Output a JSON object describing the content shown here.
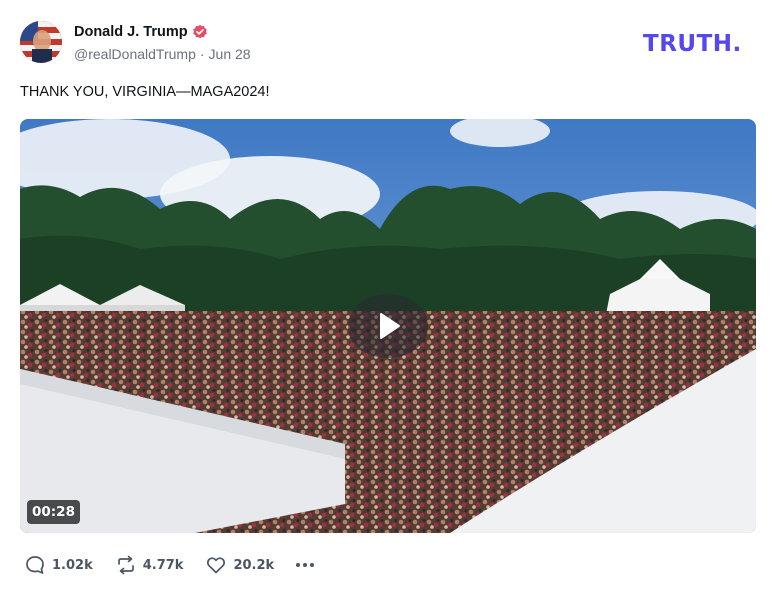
{
  "post": {
    "author": {
      "display_name": "Donald J. Trump",
      "handle": "@realDonaldTrump",
      "verified": true
    },
    "separator": "·",
    "date": "Jun 28",
    "text": "THANK YOU, VIRGINIA—MAGA2024!",
    "media": {
      "type": "video",
      "duration": "00:28"
    },
    "stats": {
      "replies": "1.02k",
      "retruths": "4.77k",
      "likes": "20.2k"
    }
  },
  "brand": {
    "logo_text": "TRUTH.",
    "logo_color": "#5448ee",
    "verified_color": "#e0506b"
  },
  "icons": {
    "verified": "verified-badge-icon",
    "play": "play-icon",
    "reply": "reply-bubble-icon",
    "retruth": "repost-arrows-icon",
    "like": "heart-icon",
    "more": "more-dots-icon"
  }
}
